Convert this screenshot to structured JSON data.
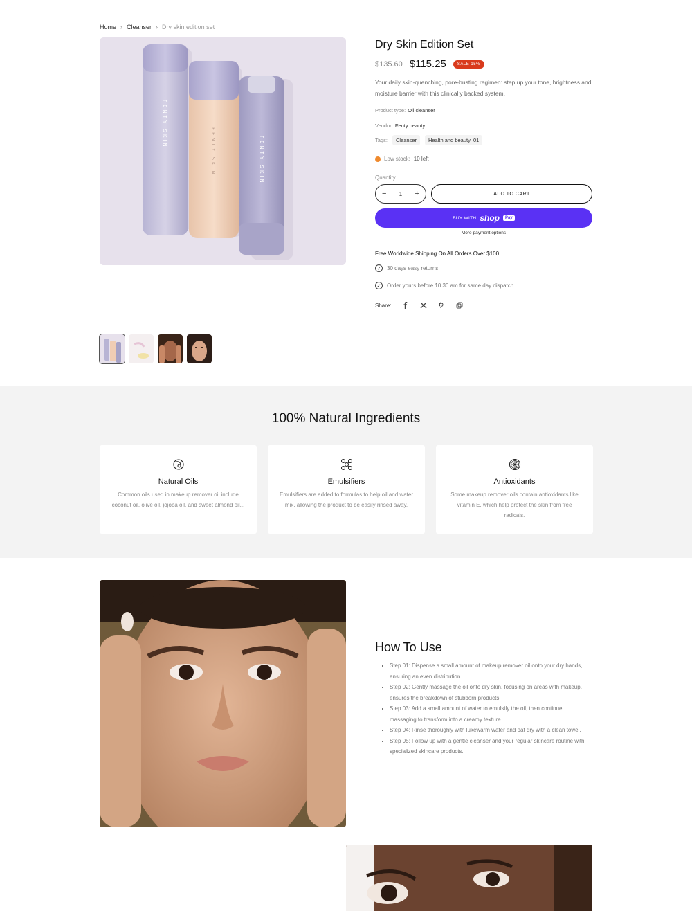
{
  "breadcrumb": {
    "home": "Home",
    "category": "Cleanser",
    "current": "Dry skin edition set",
    "sep": "›"
  },
  "product": {
    "title": "Dry Skin Edition Set",
    "compare_price": "$135.60",
    "price": "$115.25",
    "sale_badge": "SALE 15%",
    "description": "Your daily skin-quenching, pore-busting regimen: step up your tone, brightness and moisture barrier with this clinically backed system.",
    "type_label": "Product type:",
    "type_value": "Oil cleanser",
    "vendor_label": "Vendor:",
    "vendor_value": "Fenty beauty",
    "tags_label": "Tags:",
    "tags": [
      "Cleanser",
      "Health and beauty_01"
    ],
    "stock_label": "Low stock:",
    "stock_value": "10 left",
    "quantity_label": "Quantity",
    "quantity": "1",
    "minus": "−",
    "plus": "+",
    "add_to_cart": "ADD TO CART",
    "buy_with": "BUY WITH",
    "shop": "shop",
    "pay": "Pay",
    "more_payment": "More payment options",
    "shipping": "Free Worldwide Shipping On All Orders Over $100",
    "features": [
      "30 days easy returns",
      "Order yours before 10.30 am for same day dispatch"
    ],
    "share_label": "Share:",
    "bottle_brand": "FENTY SKIN",
    "share_icons": [
      "facebook-icon",
      "x-icon",
      "pinterest-icon",
      "copy-link-icon"
    ]
  },
  "ingredients": {
    "title": "100% Natural Ingredients",
    "cards": [
      {
        "title": "Natural Oils",
        "text": "Common oils used in makeup remover oil include coconut oil, olive oil, jojoba oil, and sweet almond oil..."
      },
      {
        "title": "Emulsifiers",
        "text": "Emulsifiers are added to formulas to help oil and water mix, allowing the product to be easily rinsed away."
      },
      {
        "title": "Antioxidants",
        "text": "Some makeup remover oils contain antioxidants like vitamin E, which help protect the skin from free radicals."
      }
    ]
  },
  "howto": {
    "title": "How To Use",
    "steps": [
      "Step 01: Dispense a small amount of makeup remover oil onto your dry hands, ensuring an even distribution.",
      "Step 02: Gently massage the oil onto dry skin, focusing on areas with makeup, ensures the breakdown of stubborn products.",
      "Step 03: Add a small amount of water to emulsify the oil, then continue massaging to transform into a creamy texture.",
      "Step 04: Rinse thoroughly with lukewarm water and pat dry with a clean towel.",
      "Step 05: Follow up with a gentle cleanser and your regular skincare routine with specialized skincare products."
    ]
  },
  "colors": {
    "accent": "#5a31f4",
    "sale": "#d93a1c",
    "stock": "#ef8a2e",
    "section_bg": "#f3f3f3"
  }
}
